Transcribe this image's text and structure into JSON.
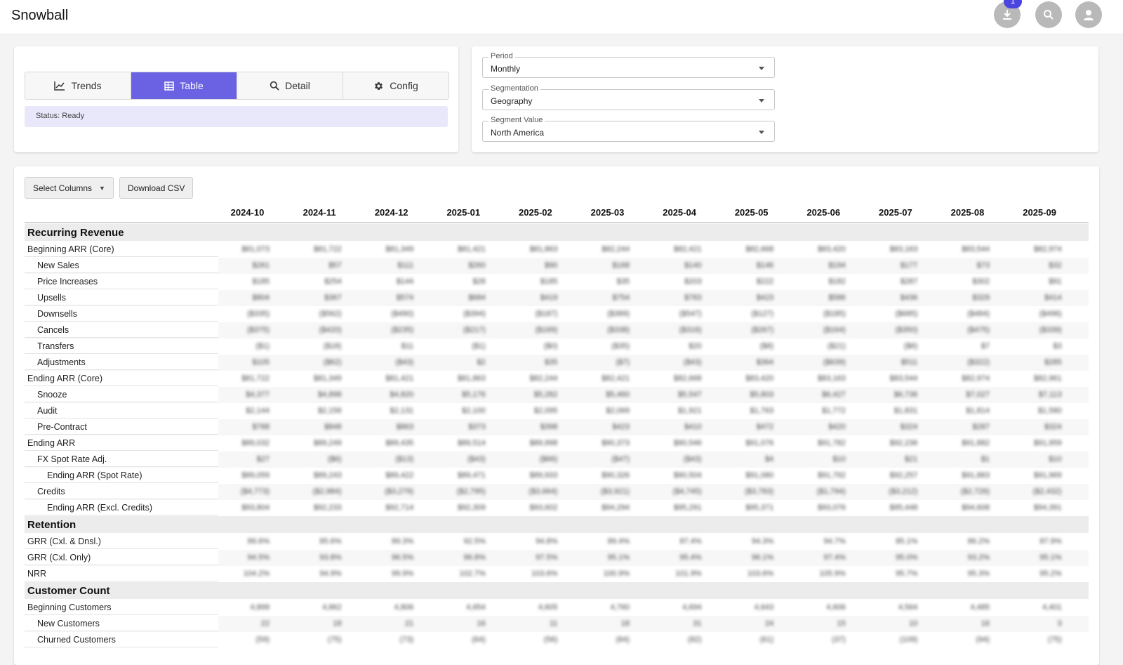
{
  "app": {
    "title": "Snowball",
    "download_badge": "1"
  },
  "tabs": [
    {
      "label": "Trends",
      "icon": "chart-line-icon"
    },
    {
      "label": "Table",
      "icon": "table-icon",
      "active": true
    },
    {
      "label": "Detail",
      "icon": "search-icon"
    },
    {
      "label": "Config",
      "icon": "gear-icon"
    }
  ],
  "status": "Status: Ready",
  "filters": {
    "period": {
      "label": "Period",
      "value": "Monthly"
    },
    "segmentation": {
      "label": "Segmentation",
      "value": "Geography"
    },
    "segment_value": {
      "label": "Segment Value",
      "value": "North America"
    }
  },
  "toolbar": {
    "select_columns": "Select Columns",
    "download_csv": "Download CSV"
  },
  "table": {
    "columns": [
      "2024-10",
      "2024-11",
      "2024-12",
      "2025-01",
      "2025-02",
      "2025-03",
      "2025-04",
      "2025-05",
      "2025-06",
      "2025-07",
      "2025-08",
      "2025-09"
    ],
    "sections": [
      {
        "title": "Recurring Revenue",
        "rows": [
          {
            "label": "Beginning ARR (Core)",
            "indent": 0,
            "values": [
              "$81,073",
              "$81,722",
              "$81,349",
              "$81,421",
              "$81,863",
              "$82,244",
              "$82,421",
              "$82,668",
              "$83,420",
              "$83,163",
              "$83,544",
              "$82,974"
            ]
          },
          {
            "label": "New Sales",
            "indent": 1,
            "values": [
              "$261",
              "$57",
              "$111",
              "$260",
              "$90",
              "$168",
              "$140",
              "$146",
              "$194",
              "$177",
              "$73",
              "$32"
            ]
          },
          {
            "label": "Price Increases",
            "indent": 1,
            "values": [
              "$185",
              "$254",
              "$144",
              "$28",
              "$185",
              "$35",
              "$203",
              "$222",
              "$182",
              "$287",
              "$302",
              "$91"
            ]
          },
          {
            "label": "Upsells",
            "indent": 1,
            "values": [
              "$804",
              "$367",
              "$574",
              "$684",
              "$419",
              "$754",
              "$783",
              "$423",
              "$586",
              "$436",
              "$329",
              "$414"
            ]
          },
          {
            "label": "Downsells",
            "indent": 1,
            "values": [
              "($335)",
              "($562)",
              "($490)",
              "($394)",
              "($187)",
              "($389)",
              "($547)",
              "($127)",
              "($185)",
              "($685)",
              "($484)",
              "($496)"
            ]
          },
          {
            "label": "Cancels",
            "indent": 1,
            "values": [
              "($375)",
              "($420)",
              "($235)",
              "($217)",
              "($169)",
              "($338)",
              "($316)",
              "($267)",
              "($164)",
              "($350)",
              "($475)",
              "($339)"
            ]
          },
          {
            "label": "Transfers",
            "indent": 1,
            "values": [
              "($1)",
              "($18)",
              "$11",
              "($1)",
              "($0)",
              "($35)",
              "$20",
              "($8)",
              "($21)",
              "($6)",
              "$7",
              "$3"
            ]
          },
          {
            "label": "Adjustments",
            "indent": 1,
            "values": [
              "$105",
              "($62)",
              "($43)",
              "$2",
              "$35",
              "($7)",
              "($43)",
              "$364",
              "($639)",
              "$511",
              "($322)",
              "$285"
            ]
          },
          {
            "label": "Ending ARR (Core)",
            "indent": 0,
            "values": [
              "$81,722",
              "$81,349",
              "$81,421",
              "$81,863",
              "$82,244",
              "$82,421",
              "$82,668",
              "$83,420",
              "$83,163",
              "$83,544",
              "$82,974",
              "$82,961"
            ]
          },
          {
            "label": "Snooze",
            "indent": 1,
            "values": [
              "$4,377",
              "$4,898",
              "$4,820",
              "$5,176",
              "$5,282",
              "$5,460",
              "$5,547",
              "$5,803",
              "$6,427",
              "$6,736",
              "$7,027",
              "$7,113"
            ]
          },
          {
            "label": "Audit",
            "indent": 1,
            "values": [
              "$2,144",
              "$2,156",
              "$2,131",
              "$2,100",
              "$2,095",
              "$2,069",
              "$1,921",
              "$1,763",
              "$1,772",
              "$1,831",
              "$1,814",
              "$1,580"
            ]
          },
          {
            "label": "Pre-Contract",
            "indent": 1,
            "values": [
              "$788",
              "$848",
              "$863",
              "$373",
              "$398",
              "$423",
              "$410",
              "$472",
              "$420",
              "$324",
              "$287",
              "$324"
            ]
          },
          {
            "label": "Ending ARR",
            "indent": 0,
            "values": [
              "$89,032",
              "$89,249",
              "$89,435",
              "$89,514",
              "$89,998",
              "$90,373",
              "$90,546",
              "$91,076",
              "$91,782",
              "$92,236",
              "$91,882",
              "$91,959"
            ]
          },
          {
            "label": "FX Spot Rate Adj.",
            "indent": 1,
            "values": [
              "$27",
              "($6)",
              "($13)",
              "($43)",
              "($66)",
              "($47)",
              "($43)",
              "$4",
              "$10",
              "$21",
              "$1",
              "$10"
            ]
          },
          {
            "label": "Ending ARR (Spot Rate)",
            "indent": 2,
            "values": [
              "$89,059",
              "$89,243",
              "$89,422",
              "$89,471",
              "$89,933",
              "$90,326",
              "$90,504",
              "$91,080",
              "$91,792",
              "$92,257",
              "$91,883",
              "$91,969"
            ]
          },
          {
            "label": "Credits",
            "indent": 1,
            "values": [
              "($4,773)",
              "($2,984)",
              "($3,279)",
              "($2,795)",
              "($3,664)",
              "($3,921)",
              "($4,745)",
              "($3,783)",
              "($1,794)",
              "($3,212)",
              "($2,726)",
              "($2,432)"
            ]
          },
          {
            "label": "Ending ARR (Excl. Credits)",
            "indent": 2,
            "values": [
              "$93,804",
              "$92,233",
              "$92,714",
              "$92,309",
              "$93,602",
              "$94,294",
              "$95,291",
              "$95,371",
              "$93,076",
              "$95,448",
              "$94,608",
              "$94,391"
            ]
          }
        ]
      },
      {
        "title": "Retention",
        "rows": [
          {
            "label": "GRR (Cxl. & Dnsl.)",
            "indent": 0,
            "values": [
              "89.6%",
              "85.6%",
              "89.3%",
              "92.5%",
              "94.8%",
              "89.4%",
              "87.4%",
              "94.3%",
              "94.7%",
              "85.1%",
              "86.2%",
              "87.9%"
            ]
          },
          {
            "label": "GRR (Cxl. Only)",
            "indent": 0,
            "values": [
              "94.5%",
              "93.8%",
              "96.5%",
              "96.8%",
              "97.5%",
              "95.1%",
              "95.4%",
              "96.1%",
              "97.4%",
              "95.0%",
              "93.2%",
              "95.1%"
            ]
          },
          {
            "label": "NRR",
            "indent": 0,
            "values": [
              "104.2%",
              "94.9%",
              "99.9%",
              "102.7%",
              "103.6%",
              "100.9%",
              "101.9%",
              "103.6%",
              "105.9%",
              "95.7%",
              "95.3%",
              "95.2%"
            ]
          }
        ]
      },
      {
        "title": "Customer Count",
        "rows": [
          {
            "label": "Beginning Customers",
            "indent": 0,
            "values": [
              "4,899",
              "4,862",
              "4,806",
              "4,654",
              "4,605",
              "4,760",
              "4,694",
              "4,643",
              "4,606",
              "4,564",
              "4,485",
              "4,401"
            ]
          },
          {
            "label": "New Customers",
            "indent": 1,
            "values": [
              "22",
              "18",
              "21",
              "16",
              "11",
              "18",
              "31",
              "24",
              "15",
              "10",
              "16",
              "3"
            ]
          },
          {
            "label": "Churned Customers",
            "indent": 1,
            "values": [
              "(59)",
              "(75)",
              "(73)",
              "(64)",
              "(56)",
              "(84)",
              "(82)",
              "(61)",
              "(37)",
              "(109)",
              "(94)",
              "(75)"
            ]
          }
        ]
      }
    ]
  }
}
